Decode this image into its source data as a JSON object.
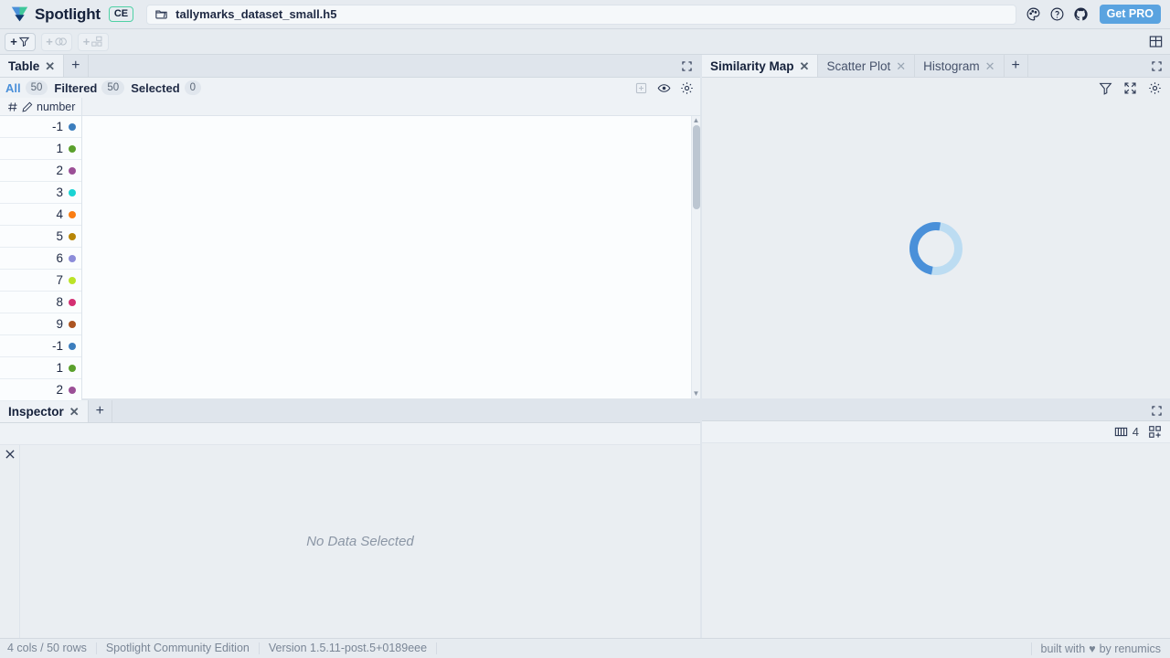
{
  "titlebar": {
    "brand": "Spotlight",
    "edition_badge": "CE",
    "file_icon": "folder-open-icon",
    "filename": "tallymarks_dataset_small.h5",
    "icons": [
      "palette-icon",
      "help-circle-icon",
      "github-icon"
    ],
    "get_pro_label": "Get PRO"
  },
  "toolbar": {
    "add_filter_label": "+",
    "add_group_label": "+",
    "add_issues_label": "+",
    "layout_icon": "layout-grid-icon"
  },
  "table_panel": {
    "tabs": [
      {
        "label": "Table",
        "active": true
      }
    ],
    "add_tab_label": "+",
    "maximize_icon": "maximize-icon",
    "status": {
      "all_label": "All",
      "all_count": "50",
      "filtered_label": "Filtered",
      "filtered_count": "50",
      "selected_label": "Selected",
      "selected_count": "0"
    },
    "actions": [
      "add-column-icon",
      "visibility-eye-icon",
      "settings-gear-icon"
    ],
    "column": {
      "type_icon": "hash-icon",
      "edit_icon": "pencil-icon",
      "name": "number"
    },
    "rows": [
      {
        "value": "-1",
        "color": "#3b7dbd"
      },
      {
        "value": "1",
        "color": "#5aa02c"
      },
      {
        "value": "2",
        "color": "#9b4f96"
      },
      {
        "value": "3",
        "color": "#1ad3d3"
      },
      {
        "value": "4",
        "color": "#fa7d12"
      },
      {
        "value": "5",
        "color": "#b78505"
      },
      {
        "value": "6",
        "color": "#8c8cd9"
      },
      {
        "value": "7",
        "color": "#bbe327"
      },
      {
        "value": "8",
        "color": "#d32f72"
      },
      {
        "value": "9",
        "color": "#ab5421"
      },
      {
        "value": "-1",
        "color": "#3b7dbd"
      },
      {
        "value": "1",
        "color": "#5aa02c"
      },
      {
        "value": "2",
        "color": "#9b4f96"
      }
    ]
  },
  "right_panel": {
    "tabs": [
      {
        "label": "Similarity Map",
        "active": true
      },
      {
        "label": "Scatter Plot",
        "active": false
      },
      {
        "label": "Histogram",
        "active": false
      }
    ],
    "add_tab_label": "+",
    "maximize_icon": "maximize-icon",
    "tools": [
      "filter-funnel-icon",
      "expand-arrows-icon",
      "settings-gear-icon"
    ],
    "loading": "loading-spinner"
  },
  "inspector": {
    "tabs": [
      {
        "label": "Inspector",
        "active": true
      }
    ],
    "add_tab_label": "+",
    "maximize_icon": "maximize-icon",
    "columns_icon": "columns-icon",
    "columns_count": "4",
    "grid_add_icon": "grid-add-icon",
    "close_icon": "close-icon",
    "empty_message": "No Data Selected"
  },
  "statusbar": {
    "dimensions": "4 cols / 50 rows",
    "edition": "Spotlight Community Edition",
    "version": "Version 1.5.11-post.5+0189eee",
    "credit_prefix": "built with",
    "credit_heart": "♥",
    "credit_suffix": "by renumics"
  },
  "colors": {
    "accent_blue": "#4a90d9",
    "badge_green": "#4fd1a5",
    "chrome": "#e6ebf0"
  }
}
